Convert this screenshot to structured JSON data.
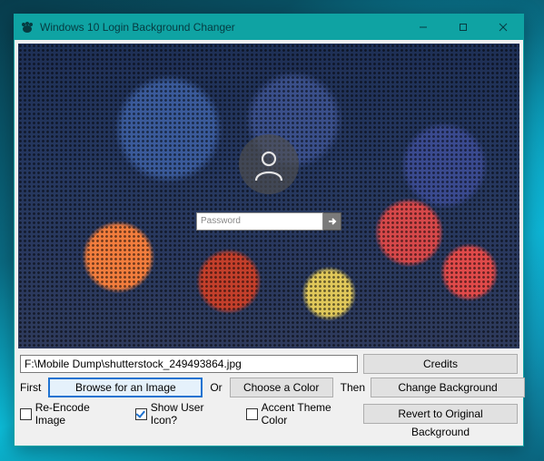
{
  "window": {
    "title": "Windows 10 Login Background Changer"
  },
  "preview": {
    "password_placeholder": "Password"
  },
  "path": {
    "value": "F:\\Mobile Dump\\shutterstock_249493864.jpg"
  },
  "buttons": {
    "credits": "Credits",
    "browse": "Browse for an Image",
    "choose_color": "Choose a Color",
    "change_bg": "Change Background",
    "revert": "Revert to Original Background"
  },
  "labels": {
    "first": "First",
    "or": "Or",
    "then": "Then"
  },
  "checkboxes": {
    "reencode": {
      "label": "Re-Encode Image",
      "checked": false
    },
    "show_user_icon": {
      "label": "Show User Icon?",
      "checked": true
    },
    "accent_theme": {
      "label": "Accent Theme Color",
      "checked": false
    }
  }
}
